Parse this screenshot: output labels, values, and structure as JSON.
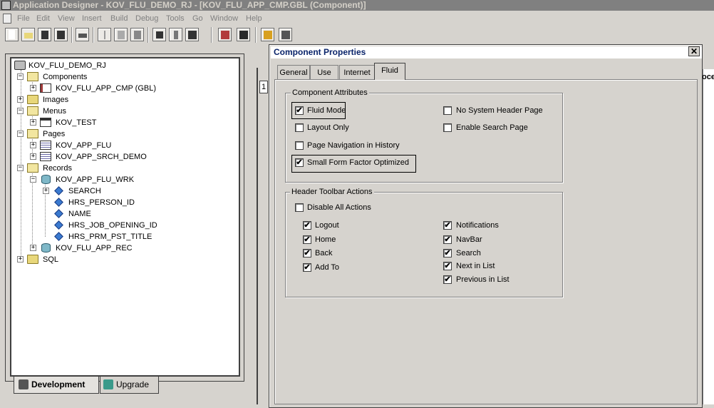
{
  "app": {
    "title": "Application Designer - KOV_FLU_DEMO_RJ - [KOV_FLU_APP_CMP.GBL (Component)]"
  },
  "menubar": {
    "items": [
      "File",
      "Edit",
      "View",
      "Insert",
      "Build",
      "Debug",
      "Tools",
      "Go",
      "Window",
      "Help"
    ]
  },
  "toolbar": {
    "buttons": [
      "new-icon",
      "open-icon",
      "save-icon",
      "save-all-icon",
      "print-icon",
      "cut-icon",
      "copy-icon",
      "paste-icon",
      "find-icon",
      "properties-icon",
      "validate-icon",
      "build-icon",
      "object-icon",
      "insert-page-icon",
      "test-icon"
    ]
  },
  "tree": {
    "root": "KOV_FLU_DEMO_RJ",
    "components": "Components",
    "component_item": "KOV_FLU_APP_CMP (GBL)",
    "images": "Images",
    "menus": "Menus",
    "menu_item": "KOV_TEST",
    "pages": "Pages",
    "page_1": "KOV_APP_FLU",
    "page_2": "KOV_APP_SRCH_DEMO",
    "records": "Records",
    "record_1": "KOV_APP_FLU_WRK",
    "field_1": "SEARCH",
    "field_2": "HRS_PERSON_ID",
    "field_3": "NAME",
    "field_4": "HRS_JOB_OPENING_ID",
    "field_5": "HRS_PRM_PST_TITLE",
    "record_2": "KOV_FLU_APP_REC",
    "sql": "SQL"
  },
  "bottom_tabs": {
    "development": "Development",
    "upgrade": "Upgrade"
  },
  "background": {
    "row_number": "1",
    "partial_header": "oce"
  },
  "dialog": {
    "title": "Component Properties",
    "close": "✕",
    "tabs": [
      "General",
      "Use",
      "Internet",
      "Fluid"
    ],
    "active_tab": "Fluid",
    "component_attributes": {
      "title": "Component Attributes",
      "fluid_mode": {
        "label": "Fluid Mode",
        "checked": true
      },
      "layout_only": {
        "label": "Layout Only",
        "checked": false
      },
      "page_nav_history": {
        "label": "Page Navigation in History",
        "checked": false
      },
      "small_form_factor": {
        "label": "Small Form Factor Optimized",
        "checked": true
      },
      "no_system_header": {
        "label": "No System Header Page",
        "checked": false
      },
      "enable_search_page": {
        "label": "Enable Search Page",
        "checked": false
      }
    },
    "header_toolbar": {
      "title": "Header Toolbar Actions",
      "disable_all": {
        "label": "Disable All Actions",
        "checked": false
      },
      "logout": {
        "label": "Logout",
        "checked": true
      },
      "home": {
        "label": "Home",
        "checked": true
      },
      "back": {
        "label": "Back",
        "checked": true
      },
      "add_to": {
        "label": "Add To",
        "checked": true
      },
      "notifications": {
        "label": "Notifications",
        "checked": true
      },
      "navbar": {
        "label": "NavBar",
        "checked": true
      },
      "search": {
        "label": "Search",
        "checked": true
      },
      "next_in_list": {
        "label": "Next in List",
        "checked": true
      },
      "previous_in_list": {
        "label": "Previous in List",
        "checked": true
      }
    }
  },
  "check_glyph": "✔"
}
